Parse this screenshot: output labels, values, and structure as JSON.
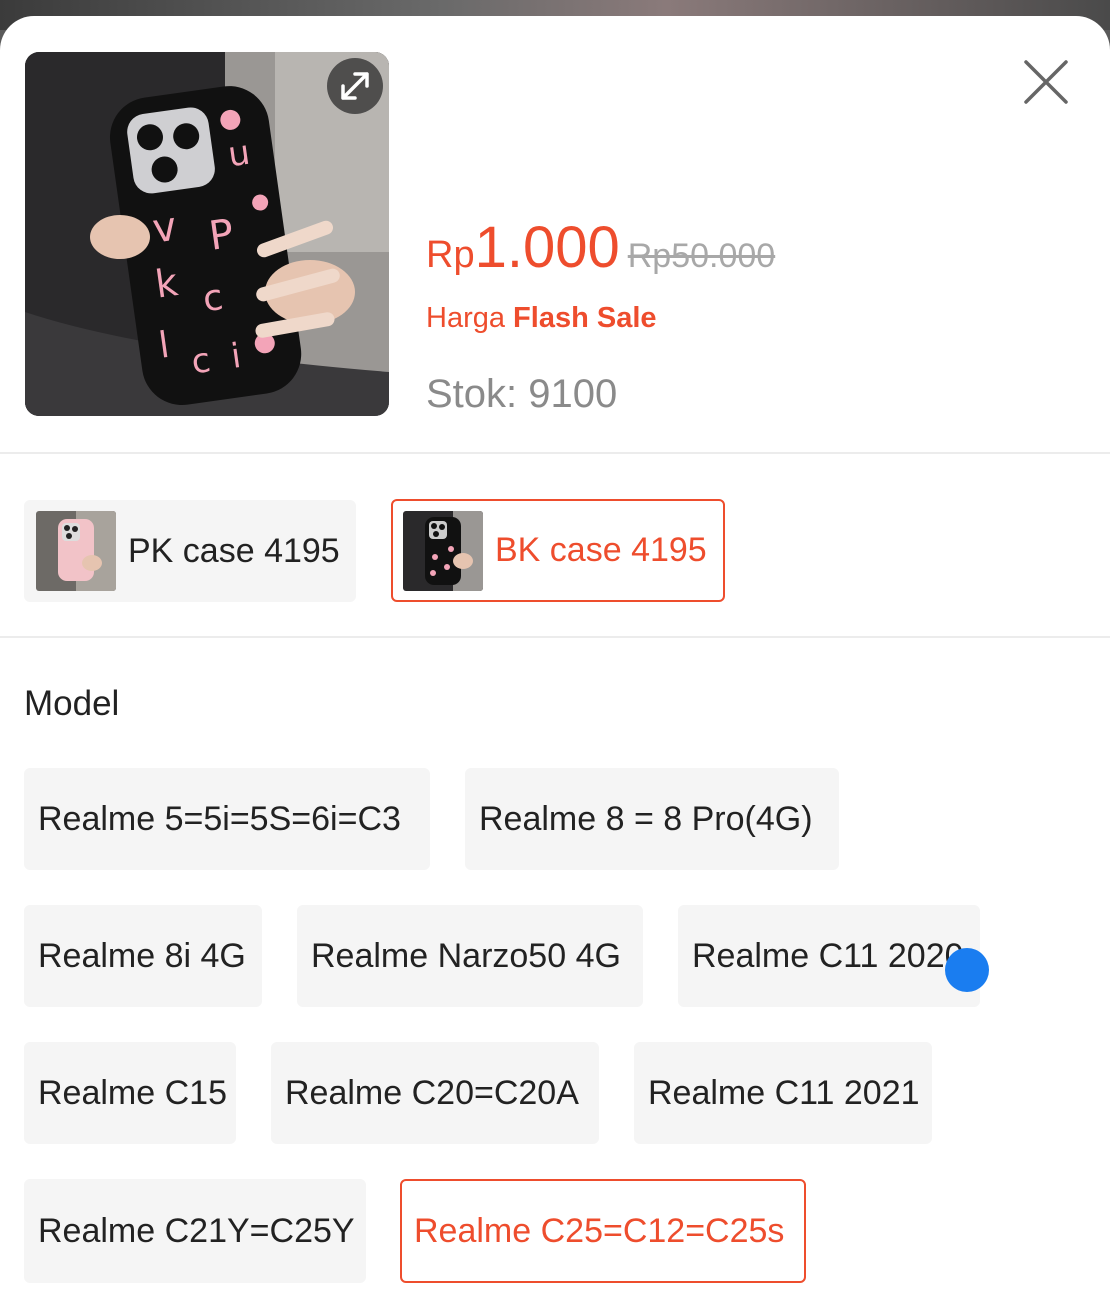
{
  "product": {
    "price_currency": "Rp",
    "price_amount": "1.000",
    "price_original": "Rp50.000",
    "flash_label_prefix": "Harga ",
    "flash_label_bold": "Flash Sale",
    "stock": "Stok: 9100"
  },
  "variants": [
    {
      "label": "PK case 4195",
      "selected": false
    },
    {
      "label": "BK case 4195",
      "selected": true
    }
  ],
  "model": {
    "title": "Model",
    "options": [
      {
        "label": "Realme 5=5i=5S=6i=C3",
        "selected": false
      },
      {
        "label": "Realme 8 = 8 Pro(4G)",
        "selected": false
      },
      {
        "label": "Realme 8i 4G",
        "selected": false
      },
      {
        "label": "Realme Narzo50 4G",
        "selected": false
      },
      {
        "label": "Realme C11 2020",
        "selected": false
      },
      {
        "label": "Realme C15",
        "selected": false
      },
      {
        "label": "Realme C20=C20A",
        "selected": false
      },
      {
        "label": "Realme C11 2021",
        "selected": false
      },
      {
        "label": "Realme C21Y=C25Y",
        "selected": false
      },
      {
        "label": "Realme C25=C12=C25s",
        "selected": true
      }
    ]
  },
  "icons": {
    "expand": "expand-icon",
    "close": "close-icon"
  },
  "colors": {
    "accent": "#ee4d2d",
    "chip_bg": "#f5f5f5",
    "touch_indicator": "#1a7df0"
  }
}
